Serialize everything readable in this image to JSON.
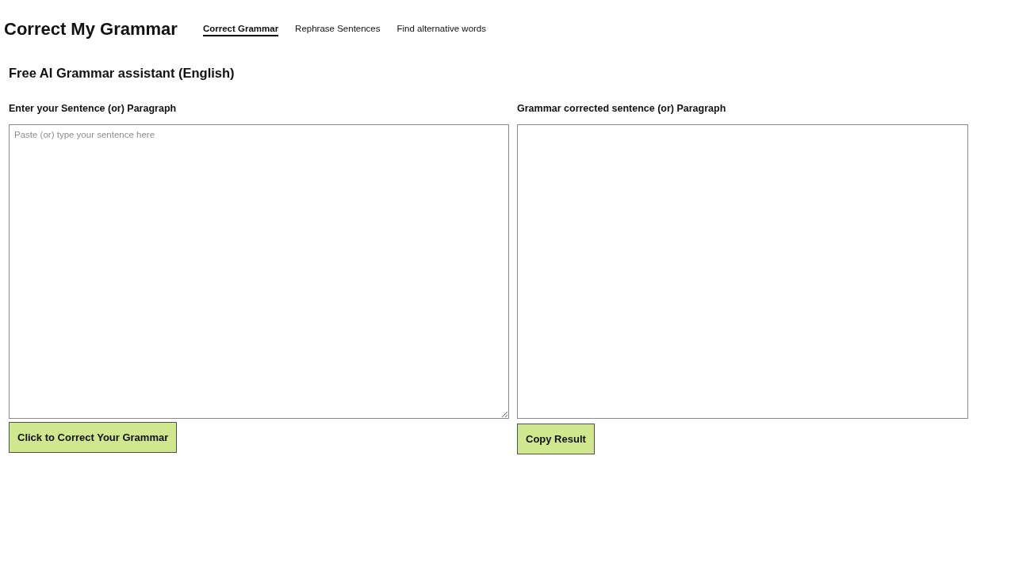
{
  "site_title": "Correct My Grammar",
  "nav_tabs": [
    {
      "label": "Correct Grammar",
      "selected": true
    },
    {
      "label": "Rephrase Sentences",
      "selected": false
    },
    {
      "label": "Find alternative words",
      "selected": false
    }
  ],
  "heading": "Free AI Grammar assistant (English)",
  "input_panel": {
    "label": "Enter your Sentence (or) Paragraph",
    "placeholder": "Paste (or) type your sentence here",
    "button": "Click to Correct Your Grammar"
  },
  "output_panel": {
    "label": "Grammar corrected sentence (or) Paragraph",
    "button": "Copy Result"
  }
}
